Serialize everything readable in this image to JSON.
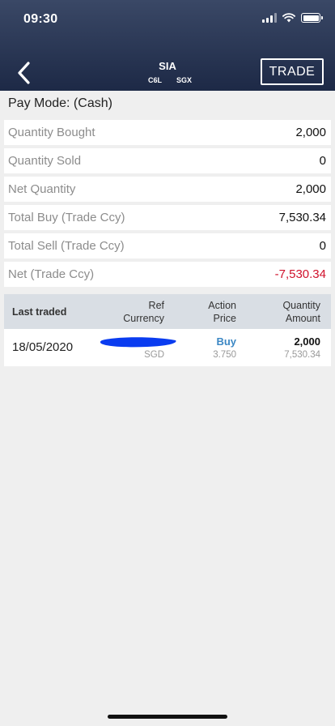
{
  "status_bar": {
    "time": "09:30"
  },
  "header": {
    "title": "SIA",
    "code": "C6L",
    "exchange": "SGX",
    "trade_label": "TRADE"
  },
  "pay_mode": "Pay Mode: (Cash)",
  "summary": [
    {
      "label": "Quantity Bought",
      "value": "2,000",
      "negative": false
    },
    {
      "label": "Quantity Sold",
      "value": "0",
      "negative": false
    },
    {
      "label": "Net Quantity",
      "value": "2,000",
      "negative": false
    },
    {
      "label": "Total Buy (Trade Ccy)",
      "value": "7,530.34",
      "negative": false
    },
    {
      "label": "Total Sell (Trade Ccy)",
      "value": "0",
      "negative": false
    },
    {
      "label": "Net (Trade Ccy)",
      "value": "-7,530.34",
      "negative": true
    }
  ],
  "trades_table": {
    "columns": {
      "last_traded": "Last traded",
      "ref": "Ref",
      "currency": "Currency",
      "action": "Action",
      "price": "Price",
      "quantity": "Quantity",
      "amount": "Amount"
    },
    "rows": [
      {
        "date": "18/05/2020",
        "currency": "SGD",
        "action": "Buy",
        "price": "3.750",
        "quantity": "2,000",
        "amount": "7,530.34"
      }
    ]
  },
  "colors": {
    "header_top": "#3a4866",
    "header_bottom": "#1d2946",
    "negative": "#d0112b",
    "action_buy": "#3b87c4",
    "redaction": "#0a3cf0"
  },
  "icons": [
    "chevron-left-icon",
    "signal-icon",
    "wifi-icon",
    "battery-icon"
  ]
}
